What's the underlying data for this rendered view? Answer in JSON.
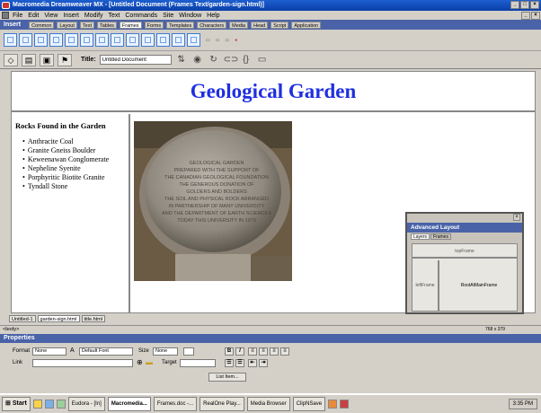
{
  "window": {
    "title": "Macromedia Dreamweaver MX - [Untitled Document (Frames Text/garden-sign.html)]",
    "minimize": "_",
    "maximize": "□",
    "close": "×"
  },
  "menubar": [
    "File",
    "Edit",
    "View",
    "Insert",
    "Modify",
    "Text",
    "Commands",
    "Site",
    "Window",
    "Help"
  ],
  "insert_bar": {
    "label": "Insert",
    "tabs": [
      "Common",
      "Layout",
      "Text",
      "Tables",
      "Frames",
      "Forms",
      "Templates",
      "Characters",
      "Media",
      "Head",
      "Script",
      "Application"
    ],
    "active_tab": "Frames"
  },
  "document_toolbar": {
    "title_label": "Title:",
    "title_value": "Untitled Document"
  },
  "page": {
    "heading": "Geological Garden",
    "heading_color": "#1f2fe0",
    "rocks_heading": "Rocks Found in the Garden",
    "rocks": [
      "Anthracite Coal",
      "Granite Gneiss Boulder",
      "Keweenawan Conglomerate",
      "Nepheline Syenite",
      "Porphyritic Biotite Granite",
      "Tyndall Stone"
    ]
  },
  "advanced_layout": {
    "title": "Advanced Layout",
    "tabs": [
      "Layers",
      "Frames"
    ],
    "frames": {
      "top": "topFrame",
      "left": "leftFrame",
      "main": "RootAtMainFrame"
    }
  },
  "doc_tabs": [
    "Untitled-1",
    "garden-sign.html",
    "title.html"
  ],
  "status": {
    "tag": "<body>",
    "size": "768 x 379"
  },
  "properties": {
    "title": "Properties",
    "format_label": "Format",
    "format_value": "None",
    "font_value": "Default Font",
    "size_label": "Size",
    "size_value": "None",
    "link_label": "Link",
    "target_label": "Target",
    "list_item": "List Item..."
  },
  "taskbar": {
    "start": "Start",
    "tasks": [
      "Eudora - [In]",
      "Macromedia...",
      "Frames.doc -...",
      "RealOne Play...",
      "Media Browser",
      "ClipNSave"
    ],
    "active_task": "Macromedia...",
    "clock": "3:35 PM"
  },
  "plaque": {
    "lines": [
      "GEOLOGICAL GARDEN",
      "PREPARED WITH THE SUPPORT OF",
      "THE CANADIAN GEOLOGICAL FOUNDATION",
      "THE GENEROUS DONATION OF",
      "GOLDERS AND BOLDERS",
      "THE SOIL AND PHYSICAL ROCK ARRANGED",
      "IN PARTNERSHIP OF MANY UNIVERSITY",
      "AND THE DEPARTMENT OF EARTH SCIENCES",
      "TODAY THIS UNIVERSITY IN 1973"
    ]
  }
}
